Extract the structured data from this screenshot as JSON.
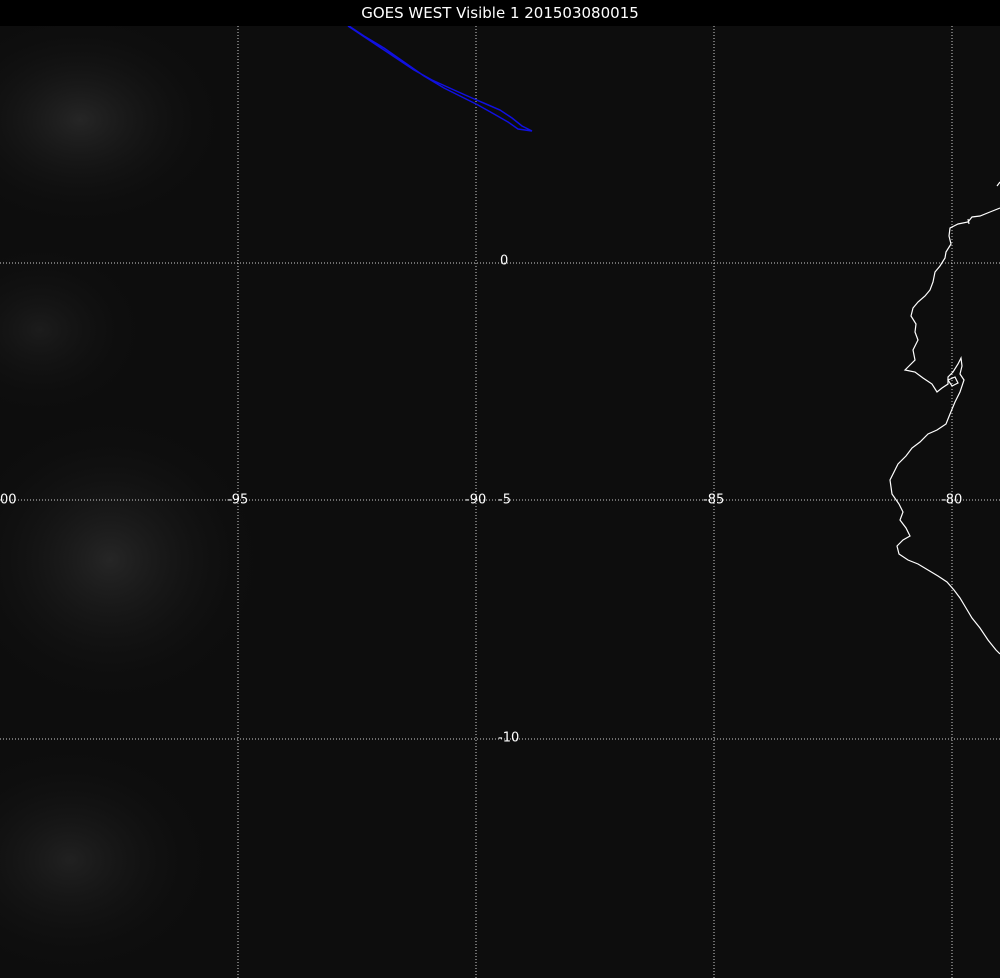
{
  "title": "GOES WEST Visible 1 201503080015",
  "satellite": "GOES WEST",
  "channel": "Visible 1",
  "timestamp": "201503080015",
  "longitude_labels": [
    "00",
    "-95",
    "-90",
    "-85",
    "-80"
  ],
  "latitude_labels": [
    "0",
    "-5",
    "-10"
  ],
  "colors": {
    "background": "#0d0d0d",
    "title_bar": "#000000",
    "grid": "#cfcfcf",
    "coastline": "#ffffff",
    "boundary": "#1010e0"
  }
}
